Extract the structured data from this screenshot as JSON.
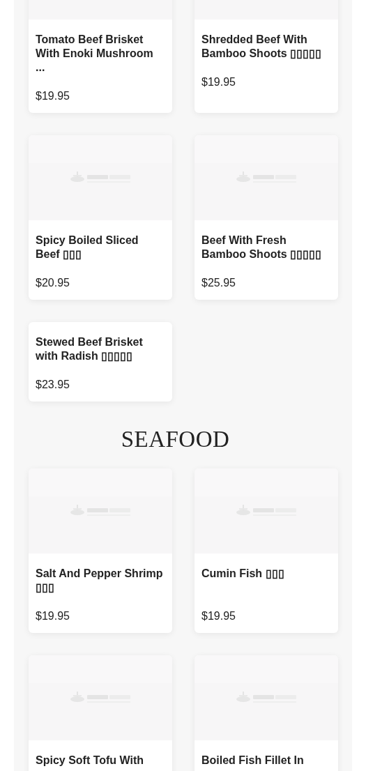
{
  "sections": [
    {
      "items": [
        {
          "kind": "with-image",
          "name": "Tomato Beef Brisket With Enoki Mushroom ...",
          "price": "$19.95"
        },
        {
          "kind": "with-image",
          "name": "Shredded Beef With Bamboo Shoots ▯▯▯▯▯",
          "price": "$19.95"
        },
        {
          "kind": "with-image",
          "name": "Spicy Boiled Sliced Beef ▯▯▯",
          "price": "$20.95"
        },
        {
          "kind": "with-image",
          "name": "Beef With Fresh Bamboo Shoots ▯▯▯▯▯",
          "price": "$25.95"
        },
        {
          "kind": "no-image",
          "name": "Stewed Beef Brisket with Radish ▯▯▯▯▯",
          "price": "$23.95"
        }
      ]
    },
    {
      "title": "SEAFOOD",
      "items": [
        {
          "kind": "with-image",
          "name": "Salt And Pepper Shrimp ▯▯▯",
          "price": "$19.95"
        },
        {
          "kind": "with-image",
          "name": "Cumin Fish ▯▯▯",
          "price": "$19.95"
        },
        {
          "kind": "with-image",
          "name": "Spicy Soft Tofu With"
        },
        {
          "kind": "with-image",
          "name": "Boiled Fish Fillet In"
        }
      ]
    }
  ]
}
